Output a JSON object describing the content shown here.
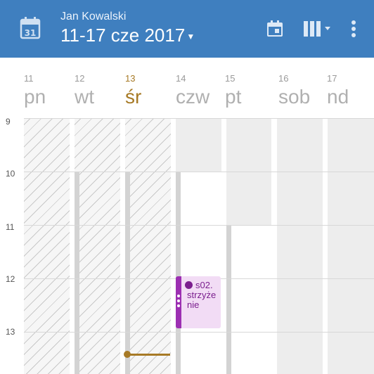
{
  "colors": {
    "topbar": "#3f7fbf",
    "today": "#a77a26",
    "event_bg": "#f2dcf5",
    "event_stripe": "#9c2fb2"
  },
  "header": {
    "user": "Jan Kowalski",
    "range": "11-17 cze 2017",
    "calendar_icon_day": "31",
    "icons": [
      "calendar-icon",
      "today-icon",
      "view-columns-icon",
      "more-vert-icon"
    ]
  },
  "days": [
    {
      "num": "11",
      "name": "pn"
    },
    {
      "num": "12",
      "name": "wt"
    },
    {
      "num": "13",
      "name": "śr"
    },
    {
      "num": "14",
      "name": "czw"
    },
    {
      "num": "15",
      "name": "pt"
    },
    {
      "num": "16",
      "name": "sob"
    },
    {
      "num": "17",
      "name": "nd"
    }
  ],
  "today_index": 2,
  "hours": [
    "9",
    "10",
    "11",
    "12",
    "13"
  ],
  "event": {
    "title": "s02. strzyżenie",
    "day": "czw",
    "start": "12:00",
    "end": "13:00"
  }
}
